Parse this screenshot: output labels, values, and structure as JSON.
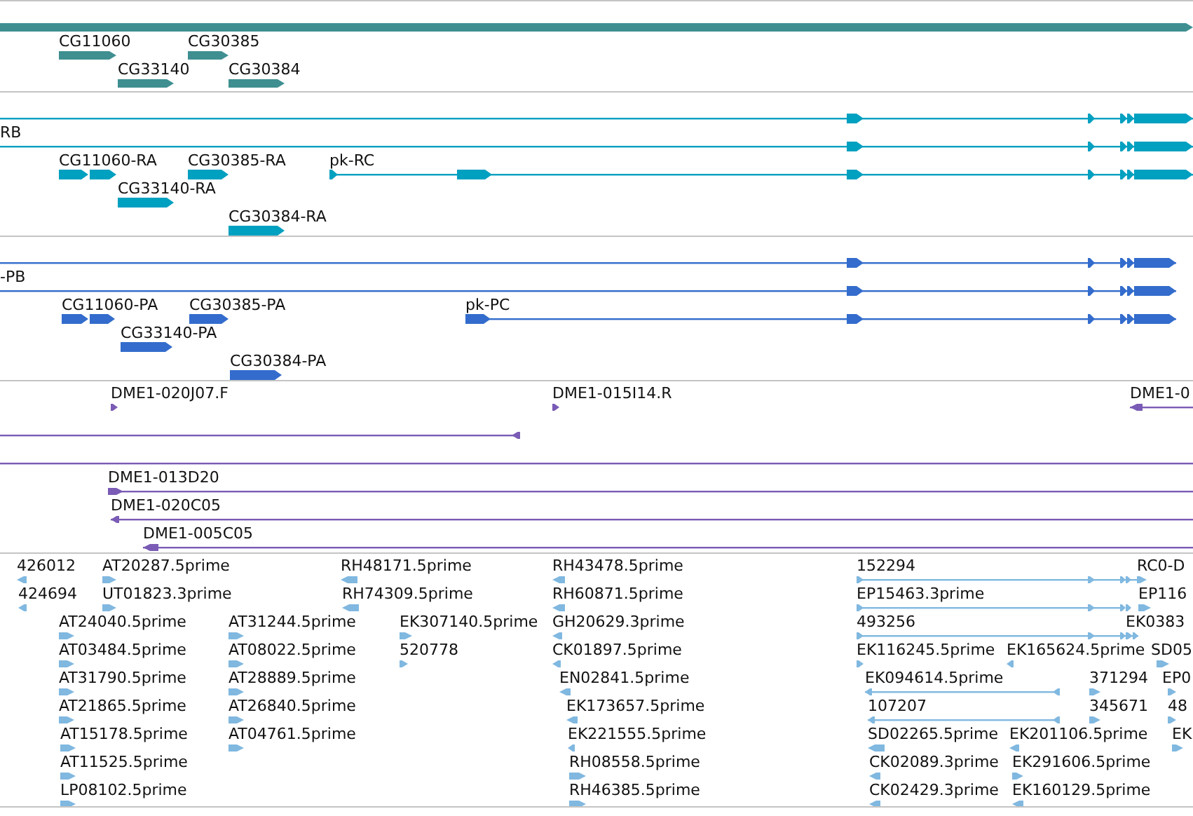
{
  "tracks": [
    {
      "color": "#3f8f91",
      "features": [
        {
          "reverse": false
        },
        {
          "label": "CG11060",
          "reverse": false
        },
        {
          "label": "CG30385",
          "reverse": false
        },
        {
          "label": "CG33140",
          "reverse": false
        },
        {
          "label": "CG30384",
          "reverse": false
        }
      ]
    },
    {
      "color": "#00a0c0",
      "features": [
        {
          "reverse": false
        },
        {
          "label": "RB",
          "reverse": false
        },
        {
          "label": "CG11060-RA",
          "reverse": false
        },
        {
          "label": "CG30385-RA",
          "reverse": false
        },
        {
          "label": "pk-RC",
          "reverse": false
        },
        {
          "label": "CG33140-RA",
          "reverse": false
        },
        {
          "label": "CG30384-RA",
          "reverse": false
        }
      ]
    },
    {
      "color": "#336ccc",
      "features": [
        {
          "reverse": false
        },
        {
          "label": "-PB",
          "reverse": false
        },
        {
          "label": "CG11060-PA",
          "reverse": false
        },
        {
          "label": "CG30385-PA",
          "reverse": false
        },
        {
          "label": "pk-PC",
          "reverse": false
        },
        {
          "label": "CG33140-PA",
          "reverse": false
        },
        {
          "label": "CG30384-PA",
          "reverse": false
        }
      ]
    },
    {
      "color": "#7a5bb5",
      "features": [
        {
          "kind": "arrow",
          "label": "DME1-020J07.F",
          "reverse": false
        },
        {
          "kind": "arrow",
          "label": "DME1-015I14.R",
          "reverse": false
        },
        {
          "kind": "arrow",
          "label": "DME1-0",
          "reverse": true
        },
        {
          "kind": "arrow",
          "reverse": true
        },
        {
          "kind": "line"
        },
        {
          "kind": "arrow",
          "label": "DME1-013D20",
          "reverse": false
        },
        {
          "kind": "arrow",
          "label": "DME1-020C05",
          "reverse": true
        },
        {
          "kind": "arrow",
          "label": "DME1-005C05",
          "reverse": true
        }
      ]
    },
    {
      "color": "#80b8e0",
      "features": [
        {
          "label": "426012",
          "reverse": true
        },
        {
          "label": "AT20287.5prime",
          "reverse": false
        },
        {
          "label": "RH48171.5prime",
          "reverse": true
        },
        {
          "label": "RH43478.5prime",
          "reverse": true
        },
        {
          "label": "152294",
          "reverse": false
        },
        {
          "label": "RC0-D",
          "reverse": false
        },
        {
          "label": "424694",
          "reverse": true
        },
        {
          "label": "UT01823.3prime",
          "reverse": false
        },
        {
          "label": "RH74309.5prime",
          "reverse": true
        },
        {
          "label": "RH60871.5prime",
          "reverse": true
        },
        {
          "label": "EP15463.3prime",
          "reverse": false
        },
        {
          "label": "EP116",
          "reverse": false
        },
        {
          "label": "AT24040.5prime",
          "reverse": false
        },
        {
          "label": "AT31244.5prime",
          "reverse": false
        },
        {
          "label": "EK307140.5prime",
          "reverse": false
        },
        {
          "label": "GH20629.3prime",
          "reverse": true
        },
        {
          "label": "493256",
          "reverse": false
        },
        {
          "label": "EK0383"
        },
        {
          "label": "AT03484.5prime",
          "reverse": false
        },
        {
          "label": "AT08022.5prime",
          "reverse": false
        },
        {
          "label": "520778",
          "reverse": false
        },
        {
          "label": "CK01897.5prime",
          "reverse": true
        },
        {
          "label": "EK116245.5prime",
          "reverse": false
        },
        {
          "label": "EK165624.5prime",
          "reverse": true
        },
        {
          "label": "SD05",
          "reverse": false
        },
        {
          "label": "AT31790.5prime",
          "reverse": false
        },
        {
          "label": "AT28889.5prime",
          "reverse": false
        },
        {
          "label": "EN02841.5prime",
          "reverse": true
        },
        {
          "label": "EK094614.5prime",
          "reverse": true
        },
        {
          "label": "371294",
          "reverse": false
        },
        {
          "label": "EP0",
          "reverse": false
        },
        {
          "label": "AT21865.5prime",
          "reverse": false
        },
        {
          "label": "AT26840.5prime",
          "reverse": false
        },
        {
          "label": "EK173657.5prime",
          "reverse": true
        },
        {
          "label": "107207",
          "reverse": true
        },
        {
          "label": "345671",
          "reverse": false
        },
        {
          "label": "48",
          "reverse": false
        },
        {
          "label": "AT15178.5prime",
          "reverse": false
        },
        {
          "label": "AT04761.5prime",
          "reverse": false
        },
        {
          "label": "EK221555.5prime",
          "reverse": true
        },
        {
          "label": "SD02265.5prime",
          "reverse": true
        },
        {
          "label": "EK201106.5prime",
          "reverse": true
        },
        {
          "label": "EK",
          "reverse": false
        },
        {
          "label": "AT11525.5prime",
          "reverse": false
        },
        {
          "label": "RH08558.5prime",
          "reverse": false
        },
        {
          "label": "CK02089.3prime",
          "reverse": true
        },
        {
          "label": "EK291606.5prime",
          "reverse": false
        },
        {
          "label": "LP08102.5prime",
          "reverse": false
        },
        {
          "label": "RH46385.5prime",
          "reverse": false
        },
        {
          "label": "CK02429.3prime",
          "reverse": true
        },
        {
          "label": "EK160129.5prime",
          "reverse": true
        }
      ]
    }
  ]
}
